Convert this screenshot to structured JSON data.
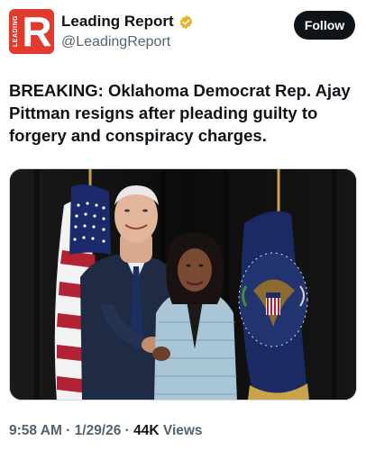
{
  "account": {
    "display_name": "Leading Report",
    "handle": "@LeadingReport",
    "avatar_side_text": "LEADING",
    "avatar_letter": "R",
    "brand_color": "#e23a2e",
    "verified_badge_color": "#e8b321"
  },
  "actions": {
    "follow_label": "Follow"
  },
  "tweet": {
    "text": "BREAKING: Oklahoma Democrat Rep. Ajay Pittman resigns after pleading guilty to forgery and conspiracy charges."
  },
  "meta": {
    "time": "9:58 AM",
    "sep1": " · ",
    "date": "1/29/26",
    "sep2": " · ",
    "views_count": "44K",
    "views_label": " Views"
  },
  "icons": {
    "verified": "verified-badge-icon"
  }
}
